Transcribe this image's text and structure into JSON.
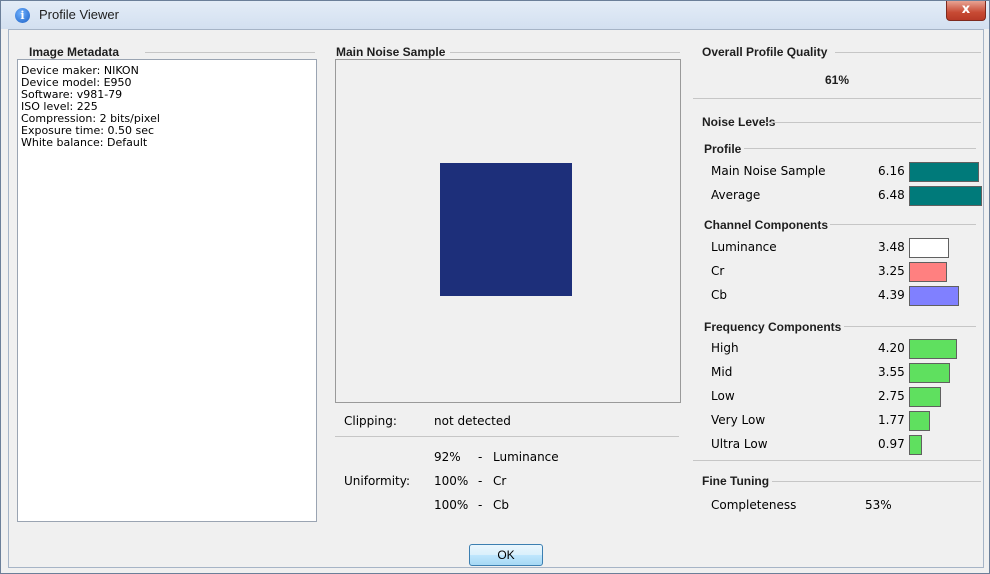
{
  "window": {
    "title": "Profile Viewer",
    "close_label": "x"
  },
  "metadata": {
    "title": "Image Metadata",
    "lines": [
      "Device maker: NIKON",
      "Device model: E950",
      "Software: v981-79",
      "ISO level: 225",
      "Compression: 2 bits/pixel",
      "Exposure time: 0.50 sec",
      "White balance: Default"
    ]
  },
  "noise_sample": {
    "title": "Main Noise Sample",
    "clipping_label": "Clipping:",
    "clipping_value": "not detected",
    "uniformity_label": "Uniformity:",
    "uniformity": [
      {
        "pct": "92%",
        "dash": "-",
        "name": "Luminance"
      },
      {
        "pct": "100%",
        "dash": "-",
        "name": "Cr"
      },
      {
        "pct": "100%",
        "dash": "-",
        "name": "Cb"
      }
    ],
    "sample_color": "#1d2f7a"
  },
  "quality": {
    "title": "Overall Profile Quality",
    "value": "61%"
  },
  "noise_levels": {
    "title": "Noise Levels",
    "profile": {
      "title": "Profile",
      "rows": [
        {
          "label": "Main Noise Sample",
          "value": "6.16",
          "color": "#007a7a"
        },
        {
          "label": "Average",
          "value": "6.48",
          "color": "#007a7a"
        }
      ]
    },
    "channel": {
      "title": "Channel Components",
      "rows": [
        {
          "label": "Luminance",
          "value": "3.48",
          "color": "#ffffff"
        },
        {
          "label": "Cr",
          "value": "3.25",
          "color": "#ff8080"
        },
        {
          "label": "Cb",
          "value": "4.39",
          "color": "#8080ff"
        }
      ]
    },
    "frequency": {
      "title": "Frequency Components",
      "rows": [
        {
          "label": "High",
          "value": "4.20",
          "color": "#5fe05f"
        },
        {
          "label": "Mid",
          "value": "3.55",
          "color": "#5fe05f"
        },
        {
          "label": "Low",
          "value": "2.75",
          "color": "#5fe05f"
        },
        {
          "label": "Very Low",
          "value": "1.77",
          "color": "#5fe05f"
        },
        {
          "label": "Ultra Low",
          "value": "0.97",
          "color": "#5fe05f"
        }
      ]
    }
  },
  "fine_tuning": {
    "title": "Fine Tuning",
    "label": "Completeness",
    "value": "53%"
  },
  "ok_label": "OK"
}
